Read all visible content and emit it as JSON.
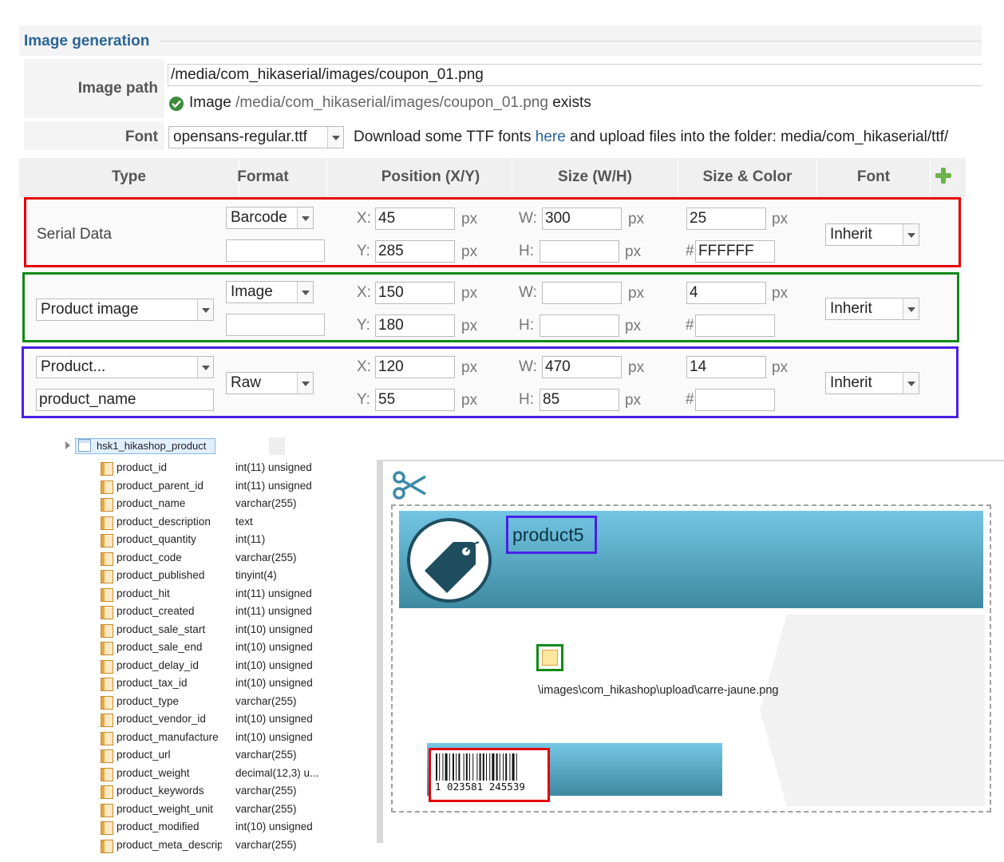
{
  "form": {
    "legend": "Image generation",
    "image_path_label": "Image path",
    "image_path_value": "/media/com_hikaserial/images/coupon_01.png",
    "exists_prefix": "Image",
    "exists_path": "/media/com_hikaserial/images/coupon_01.png",
    "exists_suffix": "exists",
    "font_label": "Font",
    "font_value": "opensans-regular.ttf",
    "font_help_before": "Download some TTF fonts",
    "font_help_link": "here",
    "font_help_after": "and upload files into the folder: media/com_hikaserial/ttf/"
  },
  "table": {
    "headers": [
      "Type",
      "Format",
      "Position (X/Y)",
      "Size (W/H)",
      "Size & Color",
      "Font"
    ],
    "px": "px",
    "x_label": "X:",
    "y_label": "Y:",
    "w_label": "W:",
    "h_label": "H:",
    "hash": "#",
    "rows": [
      {
        "type_label": "Serial Data",
        "format": "Barcode",
        "format_extra": "",
        "x": "45",
        "y": "285",
        "w": "300",
        "h": "",
        "size": "25",
        "color": "FFFFFF",
        "font": "Inherit"
      },
      {
        "type_select": "Product image",
        "format": "Image",
        "format_extra": "",
        "x": "150",
        "y": "180",
        "w": "",
        "h": "",
        "size": "4",
        "color": "",
        "font": "Inherit"
      },
      {
        "type_select": "Product...",
        "type_field": "product_name",
        "format": "Raw",
        "x": "120",
        "y": "55",
        "w": "470",
        "h": "85",
        "size": "14",
        "color": "",
        "font": "Inherit"
      }
    ]
  },
  "db": {
    "table_name": "hsk1_hikashop_product",
    "columns": [
      {
        "name": "product_id",
        "type": "int(11) unsigned"
      },
      {
        "name": "product_parent_id",
        "type": "int(11) unsigned"
      },
      {
        "name": "product_name",
        "type": "varchar(255)"
      },
      {
        "name": "product_description",
        "type": "text"
      },
      {
        "name": "product_quantity",
        "type": "int(11)"
      },
      {
        "name": "product_code",
        "type": "varchar(255)"
      },
      {
        "name": "product_published",
        "type": "tinyint(4)"
      },
      {
        "name": "product_hit",
        "type": "int(11) unsigned"
      },
      {
        "name": "product_created",
        "type": "int(11) unsigned"
      },
      {
        "name": "product_sale_start",
        "type": "int(10) unsigned"
      },
      {
        "name": "product_sale_end",
        "type": "int(10) unsigned"
      },
      {
        "name": "product_delay_id",
        "type": "int(10) unsigned"
      },
      {
        "name": "product_tax_id",
        "type": "int(10) unsigned"
      },
      {
        "name": "product_type",
        "type": "varchar(255)"
      },
      {
        "name": "product_vendor_id",
        "type": "int(10) unsigned"
      },
      {
        "name": "product_manufacture",
        "type": "int(10) unsigned"
      },
      {
        "name": "product_url",
        "type": "varchar(255)"
      },
      {
        "name": "product_weight",
        "type": "decimal(12,3) u..."
      },
      {
        "name": "product_keywords",
        "type": "varchar(255)"
      },
      {
        "name": "product_weight_unit",
        "type": "varchar(255)"
      },
      {
        "name": "product_modified",
        "type": "int(10) unsigned"
      },
      {
        "name": "product_meta_descrip",
        "type": "varchar(255)"
      }
    ]
  },
  "preview": {
    "product_text": "product5",
    "image_path_text": "\\images\\com_hikashop\\upload\\carre-jaune.png",
    "barcode_number": "1 023581 245539"
  },
  "colors": {
    "accent": "#2a6496",
    "frame_red": "#e20000",
    "frame_green": "#0f8a18",
    "frame_blue": "#4b1fe6"
  },
  "icons": [
    "check-icon",
    "plus-icon",
    "dropdown-arrow-icon",
    "table-icon",
    "column-icon",
    "scissors-icon",
    "price-tag-icon",
    "barcode-icon"
  ]
}
